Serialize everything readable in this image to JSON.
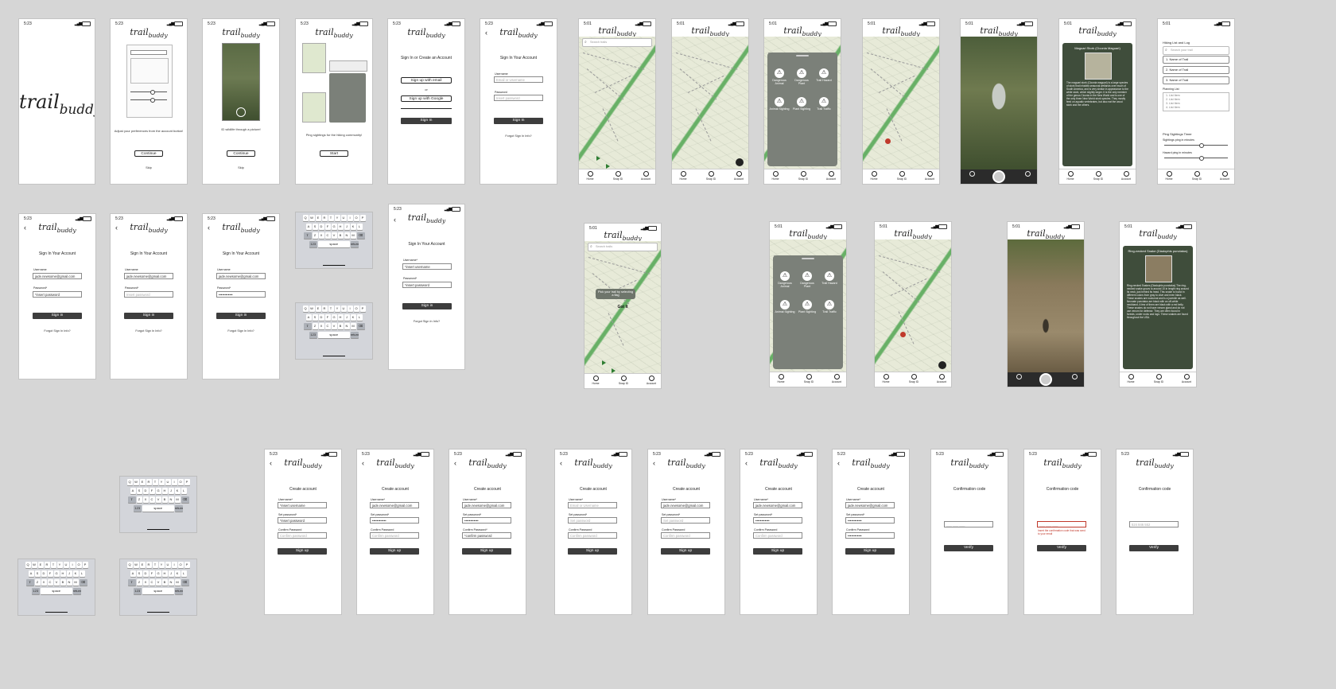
{
  "status": {
    "time_a": "5:23",
    "time_b": "5:01"
  },
  "brand": {
    "logo_main": "trail",
    "logo_sub": "buddy"
  },
  "onboarding": {
    "prefs_caption": "Adjust your preferences from the account button!",
    "id_caption": "ID wildlife through a picture!",
    "ping_caption": "Ping sightings for the hiking community!",
    "continue": "Continue",
    "skip": "Skip",
    "start": "Start"
  },
  "auth": {
    "signin_or_create": "Sign In or Create an Account",
    "signup_email": "Sign up with email",
    "or": "or",
    "signup_google": "Sign up with Google",
    "sign_in": "Sign In",
    "signin_title": "Sign In Your Account",
    "username_label": "Username",
    "username_label_req": "Username*",
    "password_label": "Password",
    "password_label_req": "Password*",
    "email_or_username_ph": "Email or Username",
    "insert_password_ph": "Insert password",
    "insert_password_ph_alt": "*insert password",
    "insert_username_ph": "*insert username",
    "email_value": "jade.newsome@gmail.com",
    "masked": "••••••••••••",
    "sign_in_btn": "Sign in",
    "forgot": "Forgot Sign In Info?",
    "create_title": "Create account",
    "set_password_label": "Set password*",
    "confirm_password_label": "Confirm Password",
    "confirm_password_label_req": "Confirm Password*",
    "set_password_ph": "Set password",
    "confirm_password_ph": "Confirm password",
    "confirm_password_ph_alt": "*confirm password",
    "sign_up": "Sign up",
    "confirmation_title": "Confirmation code",
    "code_ph": "___ ___ ___",
    "code_value": "524 846 552",
    "code_error": "Insert the confirmation code that was send to your email",
    "verify": "Verify"
  },
  "map": {
    "search_ph": "Search trails",
    "tooltip": "Pick your trail by selecting a flag",
    "got_it": "Got It"
  },
  "nav": {
    "home": "Home",
    "snap": "Snap ID",
    "account": "Account"
  },
  "categories": [
    "Dangerous Animal",
    "Dangerous Plant",
    "Trail Hazard",
    "Animal Sighting",
    "Plant Sighting",
    "Trail Traffic"
  ],
  "stork": {
    "title": "Maguari Stork (Ciconia Maguari)",
    "body": "The maguari stork (Ciconia maguari) is a large species of stork that inhabits seasonal wetlands over much of South America, and is very similar in appearance to the white stork, which slightly larger. It is the only member of the genus Ciconia in the New World and is one of the only three New World stork species. They mostly feed on aquatic vertebrates, but also eat the wood stork and the others."
  },
  "snake": {
    "title": "Ring-necked Snake (Diadophis punctatus)",
    "body": "Ring-necked Snakes (Diadophis punctatus) The ring-necked snake grows to around 10 in length ring around its neck, just behind its head. This snake is found in different colors from gray to olive and even black. These snakes are nocturnal and is a juvenile as well. Neonate punctatus are black with an off-white neckband. A few of them are black with a red belly. These snakes do not have venom gland and do not use venom for defense. They are often found in forests, under rocks and logs. These snakes are found throughout the USA."
  },
  "planning": {
    "header": "Hiking List and Log",
    "search_ph": "Search your trail",
    "trails": [
      "1. Name of Trail",
      "2. Name of Trail",
      "3. Name of Trail"
    ],
    "planning_list": "Planning List",
    "list_items": [
      "1. List Item",
      "2. List Item",
      "3. List Item",
      "4. List Item"
    ],
    "ping_timer": "Ping Sightings Timer",
    "ping_every": "Sightings ping in minutes",
    "hazard_every": "Hazard ping in minutes"
  },
  "keyboard": {
    "row1": [
      "Q",
      "W",
      "E",
      "R",
      "T",
      "Y",
      "U",
      "I",
      "O",
      "P"
    ],
    "row2": [
      "A",
      "S",
      "D",
      "F",
      "G",
      "H",
      "J",
      "K",
      "L"
    ],
    "row3": [
      "Z",
      "X",
      "C",
      "V",
      "B",
      "N",
      "M"
    ],
    "shift": "⇧",
    "del": "⌫",
    "num": "123",
    "space": "space",
    "ret": "return"
  }
}
